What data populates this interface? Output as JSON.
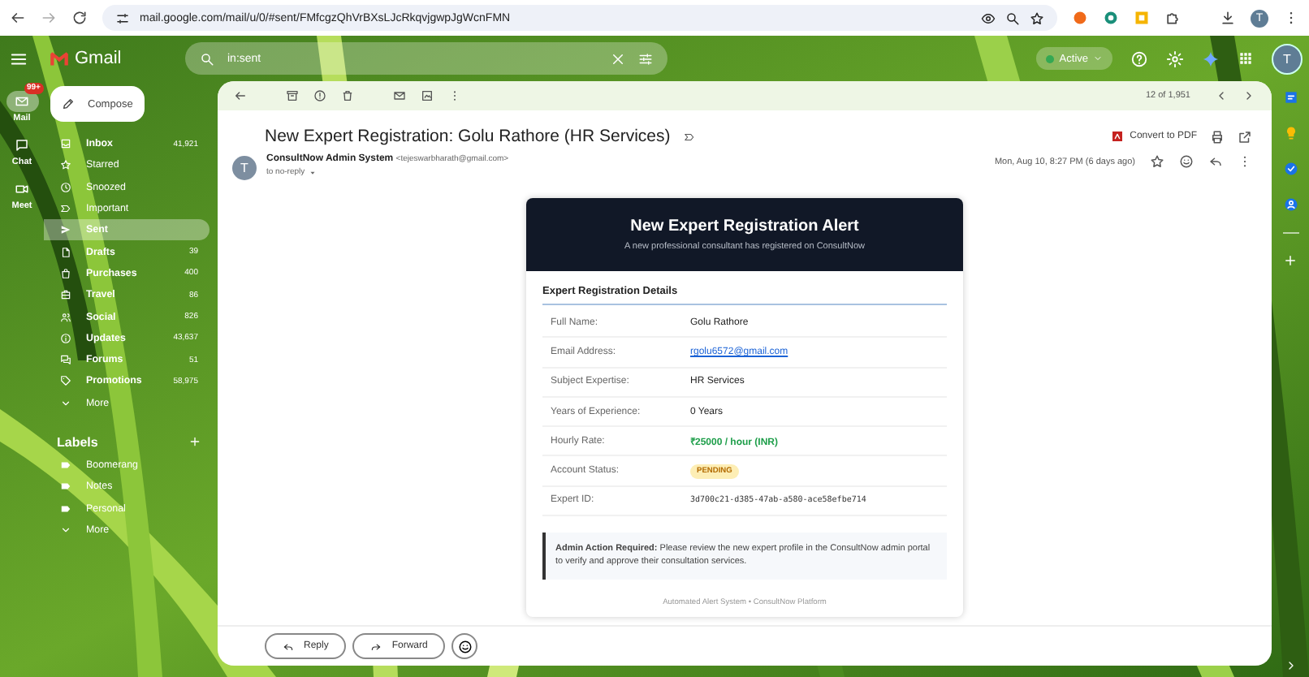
{
  "browser": {
    "url": "mail.google.com/mail/u/0/#sent/FMfcgzQhVrBXsLJcRkqvjgwpJgWcnFMN",
    "profile": "T"
  },
  "header": {
    "app_name": "Gmail",
    "search": {
      "value": "in:sent"
    },
    "status": "Active",
    "avatar": "T"
  },
  "rail": [
    {
      "label": "Mail",
      "badge": "99+",
      "selected": true
    },
    {
      "label": "Chat",
      "selected": false
    },
    {
      "label": "Meet",
      "selected": false
    }
  ],
  "compose": "Compose",
  "folders": [
    {
      "kind": "folder",
      "label": "Inbox",
      "count": "41,921",
      "unread": true,
      "selected": false
    },
    {
      "kind": "folder",
      "label": "Starred",
      "unread": false,
      "selected": false
    },
    {
      "kind": "folder",
      "label": "Snoozed",
      "unread": false,
      "selected": false
    },
    {
      "kind": "folder",
      "label": "Important",
      "unread": false,
      "selected": false
    },
    {
      "kind": "folder",
      "label": "Sent",
      "unread": false,
      "selected": true
    },
    {
      "kind": "folder",
      "label": "Drafts",
      "count": "39",
      "unread": true,
      "selected": false
    },
    {
      "kind": "folder",
      "label": "Purchases",
      "count": "400",
      "unread": true,
      "selected": false
    },
    {
      "kind": "folder",
      "label": "Travel",
      "count": "86",
      "unread": true,
      "selected": false
    },
    {
      "kind": "folder",
      "label": "Social",
      "count": "826",
      "unread": true,
      "selected": false
    },
    {
      "kind": "folder",
      "label": "Updates",
      "count": "43,637",
      "unread": true,
      "selected": false
    },
    {
      "kind": "folder",
      "label": "Forums",
      "count": "51",
      "unread": true,
      "selected": false
    },
    {
      "kind": "folder",
      "label": "Promotions",
      "count": "58,975",
      "unread": true,
      "selected": false
    },
    {
      "kind": "more",
      "label": "More",
      "unread": false,
      "selected": false
    }
  ],
  "labels": {
    "title": "Labels",
    "items": [
      {
        "kind": "label",
        "label": "Boomerang"
      },
      {
        "kind": "label",
        "label": "Notes"
      },
      {
        "kind": "label",
        "label": "Personal"
      },
      {
        "kind": "more",
        "label": "More"
      }
    ]
  },
  "toolbar": {
    "position": "12 of 1,951"
  },
  "message": {
    "subject": "New Expert Registration: Golu Rathore (HR Services)",
    "convert_pdf": "Convert to PDF",
    "sender": {
      "name": "ConsultNow Admin System",
      "email": "<tejeswarbharath@gmail.com>",
      "avatar": "T"
    },
    "recipient": "to no-reply",
    "date": "Mon, Aug 10, 8:27 PM (6 days ago)"
  },
  "alert_email": {
    "title": "New Expert Registration Alert",
    "subtitle": "A new professional consultant has registered on ConsultNow",
    "section": "Expert Registration Details",
    "fields": [
      {
        "label": "Full Name:",
        "value": "Golu Rathore",
        "kind": "text"
      },
      {
        "label": "Email Address:",
        "value": "rgolu6572@gmail.com",
        "kind": "link"
      },
      {
        "label": "Subject Expertise:",
        "value": "HR Services",
        "kind": "text"
      },
      {
        "label": "Years of Experience:",
        "value": "0 Years",
        "kind": "text"
      },
      {
        "label": "Hourly Rate:",
        "value": "₹25000 / hour (INR)",
        "kind": "money"
      },
      {
        "label": "Account Status:",
        "value": "PENDING",
        "kind": "badge"
      },
      {
        "label": "Expert ID:",
        "value": "3d700c21-d385-47ab-a580-ace58efbe714",
        "kind": "code"
      }
    ],
    "notice": "**Admin Action Required:** Please review the new expert profile in the ConsultNow admin portal to verify and approve their consultation services.",
    "footer": "Automated Alert System • ConsultNow Platform"
  },
  "actions": [
    {
      "kind": "reply",
      "label": "Reply"
    },
    {
      "kind": "forward",
      "label": "Forward"
    }
  ]
}
